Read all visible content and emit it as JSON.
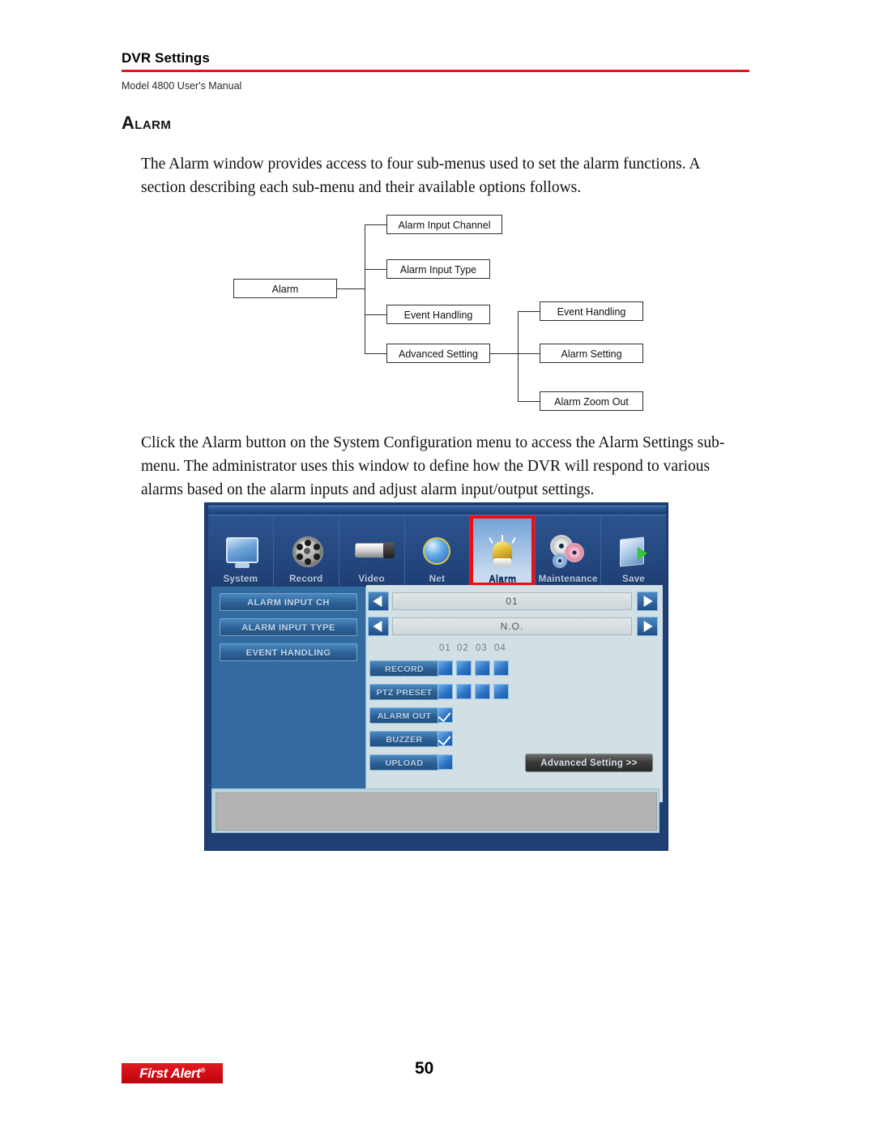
{
  "header": {
    "title": "DVR Settings",
    "subtitle": "Model 4800 User's Manual",
    "rule_color": "#e8131a"
  },
  "section": {
    "heading_cap": "A",
    "heading_rest": "LARM"
  },
  "paragraphs": {
    "p1": "The Alarm window provides access to four sub-menus used to set the alarm functions. A section describing each sub-menu and their available options follows.",
    "p2": "Click the Alarm button on the System Configuration menu to access the Alarm Settings sub-menu. The administrator uses this window to define how the DVR will respond to various alarms based on the alarm inputs and adjust alarm input/output settings."
  },
  "tree": {
    "root": "Alarm",
    "level1": [
      "Alarm Input Channel",
      "Alarm Input Type",
      "Event Handling",
      "Advanced Setting"
    ],
    "level2": [
      "Event Handling",
      "Alarm Setting",
      "Alarm Zoom Out"
    ]
  },
  "dvr": {
    "toolbar": [
      {
        "label": "System",
        "icon": "monitor-icon",
        "selected": false
      },
      {
        "label": "Record",
        "icon": "film-reel-icon",
        "selected": false
      },
      {
        "label": "Video",
        "icon": "camera-icon",
        "selected": false
      },
      {
        "label": "Net",
        "icon": "network-globe-icon",
        "selected": false
      },
      {
        "label": "Alarm",
        "icon": "alarm-beacon-icon",
        "selected": true
      },
      {
        "label": "Maintenance",
        "icon": "gears-icon",
        "selected": false
      },
      {
        "label": "Save",
        "icon": "save-disk-icon",
        "selected": false
      }
    ],
    "highlight_color": "#ee0d12",
    "side_buttons": [
      "ALARM INPUT CH",
      "ALARM INPUT TYPE",
      "EVENT HANDLING"
    ],
    "spinners": [
      {
        "name": "alarm-input-ch",
        "value": "01"
      },
      {
        "name": "alarm-input-type",
        "value": "N.O."
      }
    ],
    "channel_headers": [
      "01",
      "02",
      "03",
      "04"
    ],
    "event_rows": [
      {
        "label": "RECORD",
        "checks": [
          false,
          false,
          false,
          false
        ]
      },
      {
        "label": "PTZ PRESET",
        "checks": [
          false,
          false,
          false,
          false
        ]
      },
      {
        "label": "ALARM OUT",
        "checks": [
          true
        ]
      },
      {
        "label": "BUZZER",
        "checks": [
          true
        ]
      },
      {
        "label": "UPLOAD",
        "checks": [
          false
        ]
      }
    ],
    "advanced_button": "Advanced Setting >>"
  },
  "footer": {
    "logo_text": "First Alert",
    "logo_mark": "®",
    "page_number": "50"
  }
}
